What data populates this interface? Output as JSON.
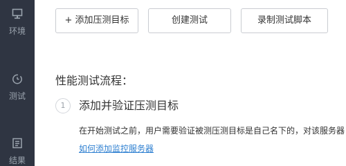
{
  "sidebar": {
    "items": [
      {
        "icon": "monitor-icon",
        "label": "环境"
      },
      {
        "icon": "timer-icon",
        "label": "测试"
      },
      {
        "icon": "report-icon",
        "label": "结果"
      }
    ]
  },
  "toolbar": {
    "add_target_label": "+ 添加压测目标",
    "create_test_label": "创建测试",
    "record_script_label": "录制测试脚本"
  },
  "flow": {
    "title": "性能测试流程：",
    "steps": [
      {
        "number": "1",
        "title": "添加并验证压测目标",
        "description": "在开始测试之前，用户需要验证被测压测目标是自己名下的，对该服务器",
        "link": "如何添加监控服务器"
      }
    ]
  },
  "colors": {
    "sidebar_bg": "#2f3542",
    "sidebar_text": "#9aa3ad",
    "link": "#2f80d1",
    "button_border": "#c9ccd1"
  }
}
